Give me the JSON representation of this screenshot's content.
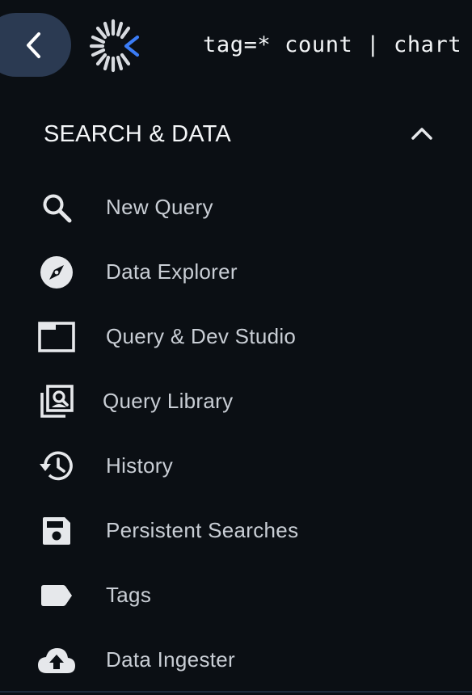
{
  "topbar": {
    "query": "tag=* count | chart"
  },
  "section": {
    "title": "SEARCH & DATA"
  },
  "menu": {
    "items": [
      {
        "label": "New Query",
        "icon": "search-icon"
      },
      {
        "label": "Data Explorer",
        "icon": "compass-icon"
      },
      {
        "label": "Query & Dev Studio",
        "icon": "window-icon"
      },
      {
        "label": "Query Library",
        "icon": "library-search-icon"
      },
      {
        "label": "History",
        "icon": "history-icon"
      },
      {
        "label": "Persistent Searches",
        "icon": "save-icon"
      },
      {
        "label": "Tags",
        "icon": "tag-icon"
      },
      {
        "label": "Data Ingester",
        "icon": "cloud-upload-icon"
      }
    ]
  },
  "colors": {
    "background": "#0b0f14",
    "back_button": "#2b3a52",
    "logo_accent": "#3b7cf5",
    "icon": "#e6e8eb",
    "label": "#c9ced5"
  }
}
